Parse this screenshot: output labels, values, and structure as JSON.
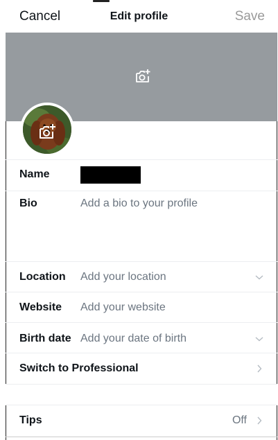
{
  "nav": {
    "cancel_label": "Cancel",
    "title": "Edit profile",
    "save_label": "Save"
  },
  "fields": {
    "name": {
      "label": "Name",
      "value": ""
    },
    "bio": {
      "label": "Bio",
      "placeholder": "Add a bio to your profile"
    },
    "location": {
      "label": "Location",
      "placeholder": "Add your location"
    },
    "website": {
      "label": "Website",
      "placeholder": "Add your website"
    },
    "birth_date": {
      "label": "Birth date",
      "placeholder": "Add your date of birth"
    }
  },
  "professional": {
    "label": "Switch to Professional"
  },
  "tips": {
    "label": "Tips",
    "value": "Off"
  },
  "colors": {
    "banner": "#969b9f",
    "placeholder_text": "#6b7580",
    "save_disabled": "#9a9a9a"
  },
  "icons": {
    "banner_camera": "camera-plus-icon",
    "avatar_camera": "camera-plus-icon",
    "dropdown": "chevron-down-icon",
    "navigate": "chevron-right-icon"
  }
}
